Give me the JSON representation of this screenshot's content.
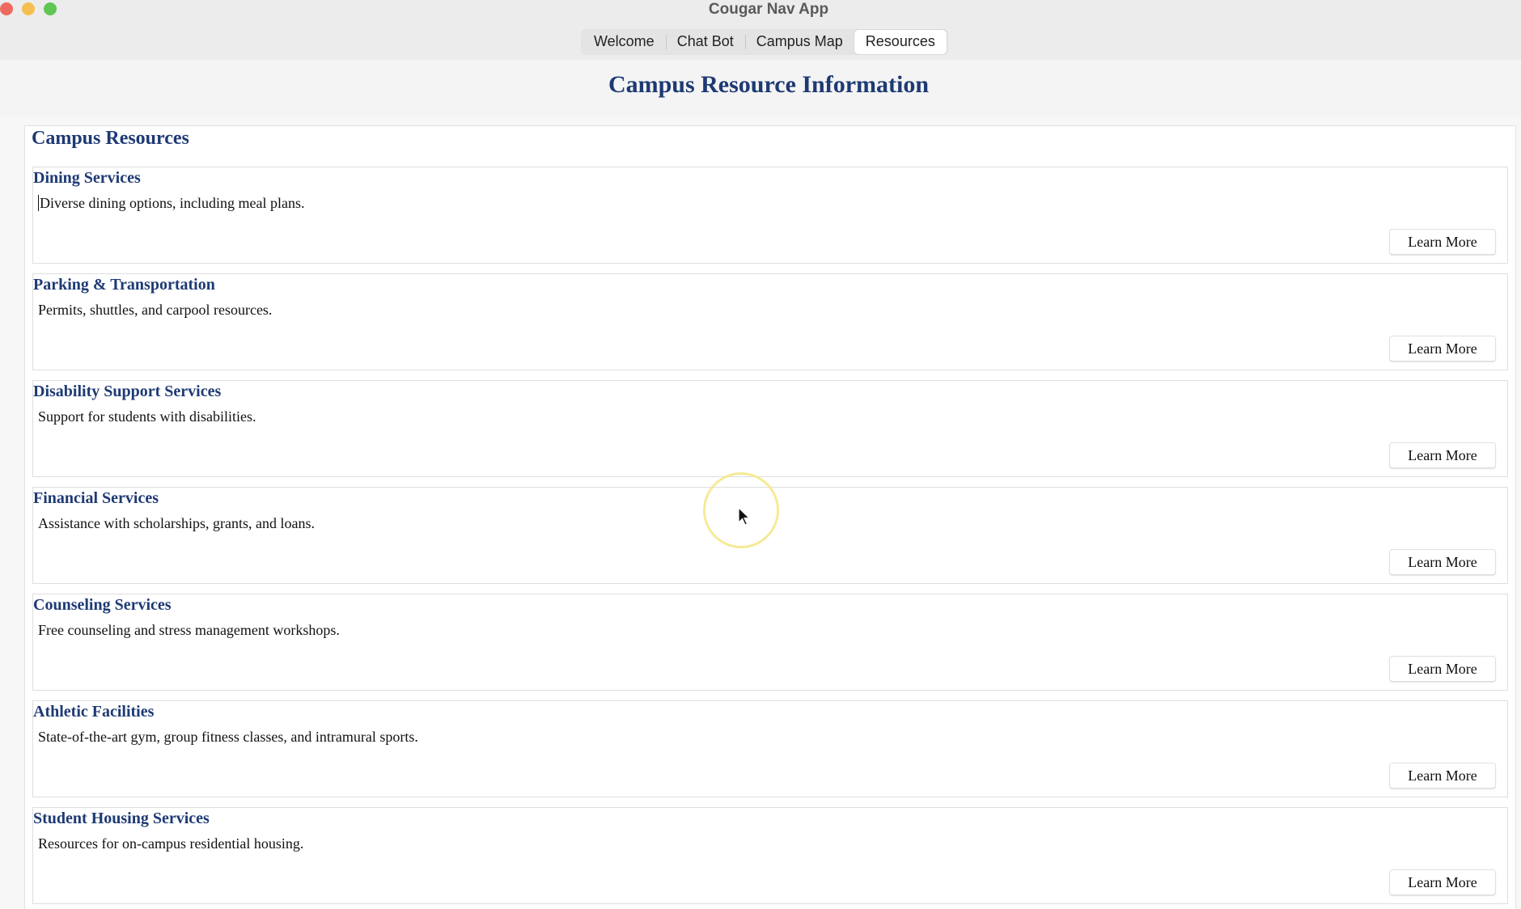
{
  "window": {
    "title": "Cougar Nav App"
  },
  "tabs": [
    {
      "label": "Welcome",
      "active": false
    },
    {
      "label": "Chat Bot",
      "active": false
    },
    {
      "label": "Campus Map",
      "active": false
    },
    {
      "label": "Resources",
      "active": true
    }
  ],
  "page": {
    "title": "Campus Resource Information"
  },
  "section": {
    "title": "Campus Resources"
  },
  "resources": [
    {
      "title": "Dining Services",
      "description": "Diverse dining options, including meal plans.",
      "button": "Learn More"
    },
    {
      "title": "Parking & Transportation",
      "description": "Permits, shuttles, and carpool resources.",
      "button": "Learn More"
    },
    {
      "title": "Disability Support Services",
      "description": "Support for students with disabilities.",
      "button": "Learn More"
    },
    {
      "title": "Financial Services",
      "description": "Assistance with scholarships, grants, and loans.",
      "button": "Learn More"
    },
    {
      "title": "Counseling Services",
      "description": "Free counseling and stress management workshops.",
      "button": "Learn More"
    },
    {
      "title": "Athletic Facilities",
      "description": "State-of-the-art gym, group fitness classes, and intramural sports.",
      "button": "Learn More"
    },
    {
      "title": "Student Housing Services",
      "description": "Resources for on-campus residential housing.",
      "button": "Learn More"
    }
  ],
  "colors": {
    "heading": "#1e3a74",
    "traffic_close": "#ee6a5f",
    "traffic_minimize": "#f5bf4f",
    "traffic_maximize": "#61c554"
  }
}
